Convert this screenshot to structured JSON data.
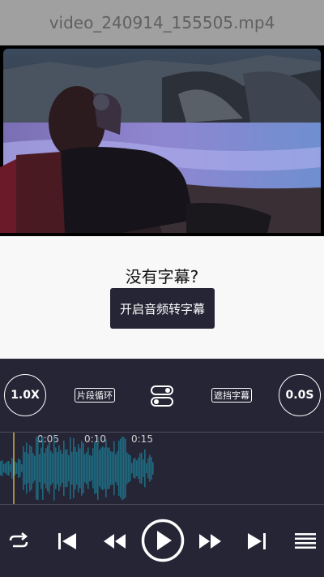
{
  "header": {
    "title": "video_240914_155505.mp4"
  },
  "subtitle_panel": {
    "prompt": "没有字幕?",
    "asr_button_label": "开启音频转字幕"
  },
  "controls": {
    "speed_label": "1.0X",
    "loop_segment_label": "片段循环",
    "block_subtitle_label": "遮挡字幕",
    "offset_label": "0.0S"
  },
  "timeline": {
    "ticks": [
      "0:05",
      "0:10",
      "0:15"
    ]
  },
  "colors": {
    "panel_bg": "#262536",
    "waveform": "#1e6a80",
    "playhead": "#c8b24a"
  }
}
